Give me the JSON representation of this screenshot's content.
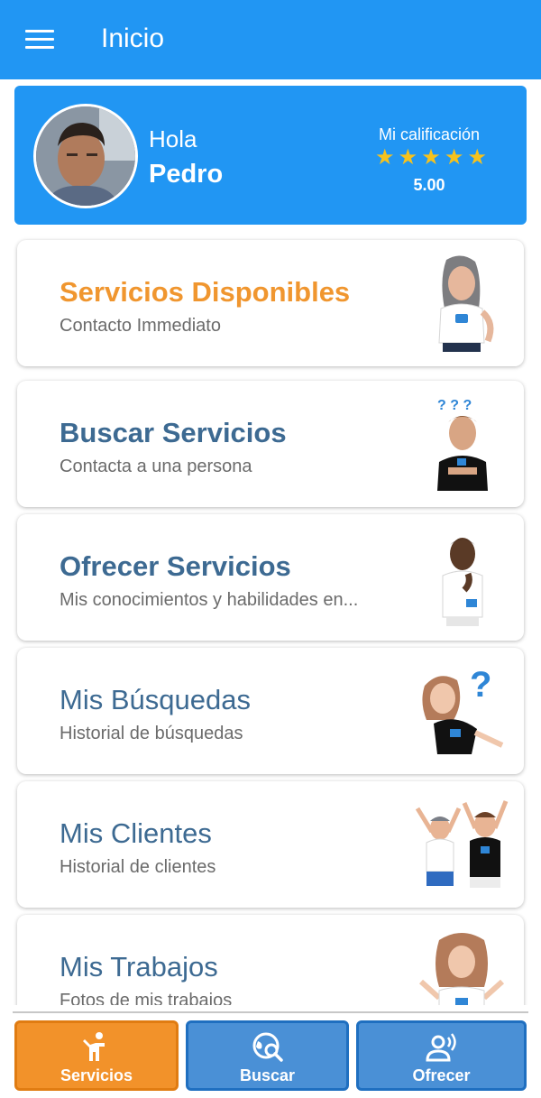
{
  "appbar": {
    "title": "Inicio"
  },
  "profile": {
    "greeting": "Hola",
    "name": "Pedro",
    "rating_label": "Mi calificación",
    "rating_value": "5.00",
    "stars": 5
  },
  "cards": [
    {
      "title": "Servicios Disponibles",
      "subtitle": "Contacto Immediato"
    },
    {
      "title": "Buscar Servicios",
      "subtitle": "Contacta a una persona"
    },
    {
      "title": "Ofrecer Servicios",
      "subtitle": "Mis conocimientos y habilidades en..."
    },
    {
      "title": "Mis Búsquedas",
      "subtitle": "Historial de búsquedas"
    },
    {
      "title": "Mis Clientes",
      "subtitle": "Historial de clientes"
    },
    {
      "title": "Mis Trabajos",
      "subtitle": "Fotos de mis trabajos"
    }
  ],
  "tabs": [
    {
      "label": "Servicios",
      "icon": "person-icon",
      "active": true
    },
    {
      "label": "Buscar",
      "icon": "globe-search-icon",
      "active": false
    },
    {
      "label": "Ofrecer",
      "icon": "voice-person-icon",
      "active": false
    }
  ],
  "colors": {
    "primary": "#2196f3",
    "accent_orange": "#f2922a",
    "title_blue": "#3d6a92",
    "star": "#f6c21d"
  }
}
